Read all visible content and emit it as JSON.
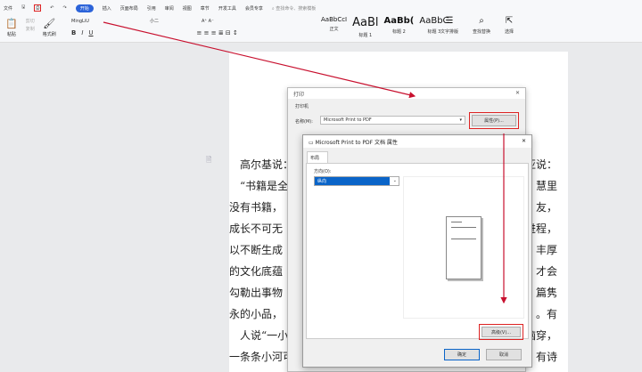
{
  "menu": {
    "file": "文件",
    "tabs": [
      "开始",
      "插入",
      "页面布局",
      "引用",
      "审阅",
      "视图",
      "章节",
      "开发工具",
      "会员专享"
    ],
    "search": "查找命令、搜索模板"
  },
  "toolbar": {
    "paste": "粘贴",
    "cut": "剪切",
    "copy": "复制",
    "format_painter": "格式刷",
    "font_name": "MingLiU",
    "font_size": "小二",
    "bold": "B",
    "italic": "I",
    "underline": "U"
  },
  "styles": [
    {
      "preview": "AaBbCcI",
      "label": "正文"
    },
    {
      "preview": "AaBl",
      "label": "标题 1"
    },
    {
      "preview": "AaBb(",
      "label": "标题 2"
    },
    {
      "preview": "AaBbC",
      "label": "标题 3"
    }
  ],
  "tools": [
    "文字排版",
    "查找替换",
    "选择"
  ],
  "document": {
    "left": [
      "高尔基说：",
      "“书籍是全",
      "没有书籍，",
      "成长不可无",
      "以不断生成",
      "的文化底蕴",
      "勾勒出事物",
      "永的小品，",
      "人说“一小",
      "一条条小河可"
    ],
    "right": [
      "亚说：",
      "慧里",
      "友，",
      "进程，",
      "丰厚",
      "才会",
      "篇隽",
      "。有",
      "脑穿，",
      "有诗"
    ]
  },
  "print_dialog": {
    "title": "打印",
    "section": "打印机",
    "name_label": "名称(M):",
    "printer": "Microsoft Print to PDF",
    "properties": "属性(P)..."
  },
  "properties_dialog": {
    "title": "Microsoft Print to PDF 文档 属性",
    "tab": "布局",
    "orientation_label": "方向(O):",
    "orientation": "纵向",
    "advanced": "高级(V)...",
    "ok": "确定",
    "cancel": "取消"
  }
}
